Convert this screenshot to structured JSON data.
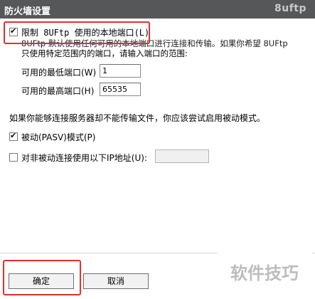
{
  "window": {
    "title": "防火墙设置",
    "brand": "8uftp"
  },
  "restrict_ports": {
    "checkbox_label": "限制 8UFtp 使用的本地端口(L)",
    "checked": true,
    "description_line1": "8UFtp 默认使用任何可用的本地端口进行连接和传输。如果你希望 8UFtp",
    "description_line2": "只使用特定范围内的端口，请输入端口的范围:"
  },
  "min_port": {
    "label": "可用的最低端口(W)",
    "value": "1"
  },
  "max_port": {
    "label": "可用的最高端口(H)",
    "value": "65535"
  },
  "pasv_hint": "如果你能够连接服务器却不能传输文件，你应该尝试启用被动模式。",
  "pasv": {
    "label": "被动(PASV)模式(P)",
    "checked": true
  },
  "non_pasv_ip": {
    "label": "对非被动连接使用以下IP地址(U):",
    "checked": false,
    "value": ""
  },
  "buttons": {
    "ok": "确定",
    "cancel": "取消"
  },
  "watermark": "软件技巧",
  "colors": {
    "title_bar": "#555759",
    "highlight": "#e03030",
    "panel": "#ffffff"
  }
}
